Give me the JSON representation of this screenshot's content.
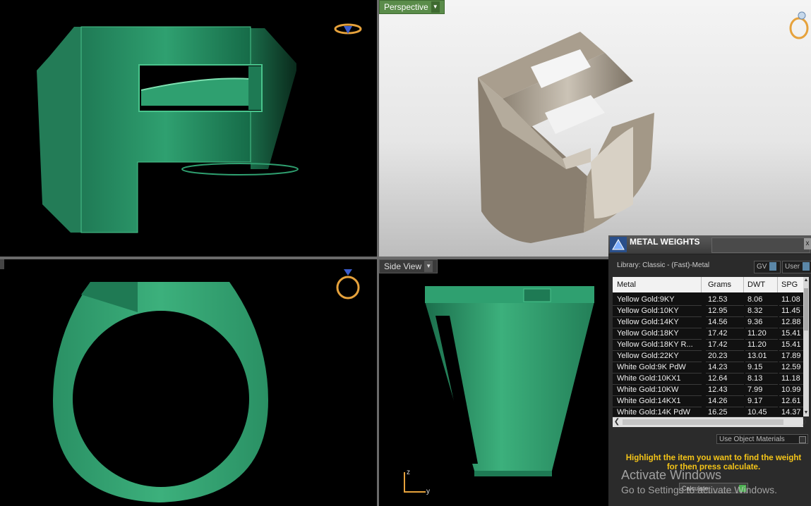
{
  "viewports": {
    "top_right": {
      "label": "Perspective",
      "dropdown_glyph": "▼"
    },
    "bottom_right": {
      "label": "Side View",
      "dropdown_glyph": "▼"
    }
  },
  "axes": {
    "z": "z",
    "y": "y"
  },
  "panel": {
    "title": "METAL WEIGHTS",
    "close_glyph": "x",
    "library": "Library: Classic - (Fast)-Metal",
    "toggle_gv": "GV",
    "toggle_user": "User",
    "columns": [
      "Metal",
      "Grams",
      "DWT",
      "SPG"
    ],
    "rows": [
      [
        "Yellow Gold:9KY",
        "12.53",
        "8.06",
        "11.08"
      ],
      [
        "Yellow Gold:10KY",
        "12.95",
        "8.32",
        "11.45"
      ],
      [
        "Yellow Gold:14KY",
        "14.56",
        "9.36",
        "12.88"
      ],
      [
        "Yellow Gold:18KY",
        "17.42",
        "11.20",
        "15.41"
      ],
      [
        "Yellow Gold:18KY R...",
        "17.42",
        "11.20",
        "15.41"
      ],
      [
        "Yellow Gold:22KY",
        "20.23",
        "13.01",
        "17.89"
      ],
      [
        "White Gold:9K PdW",
        "14.23",
        "9.15",
        "12.59"
      ],
      [
        "White Gold:10KX1",
        "12.64",
        "8.13",
        "11.18"
      ],
      [
        "White Gold:10KW",
        "12.43",
        "7.99",
        "10.99"
      ],
      [
        "White Gold:14KX1",
        "14.26",
        "9.17",
        "12.61"
      ],
      [
        "White Gold:14K PdW",
        "16.25",
        "10.45",
        "14.37"
      ]
    ],
    "use_object_materials": "Use Object Materials",
    "hint": "Highlight the item you want to find the weight for then press calculate.",
    "calculate": "Calculate",
    "watermark_line1": "Activate Windows",
    "watermark_line2": "Go to Settings to activate Windows."
  },
  "colors": {
    "ring_green": "#2fa070",
    "ring_metal": "#b9b0a2",
    "hint_yellow": "#f5c518",
    "perspective_tag": "#5a8c4a"
  }
}
